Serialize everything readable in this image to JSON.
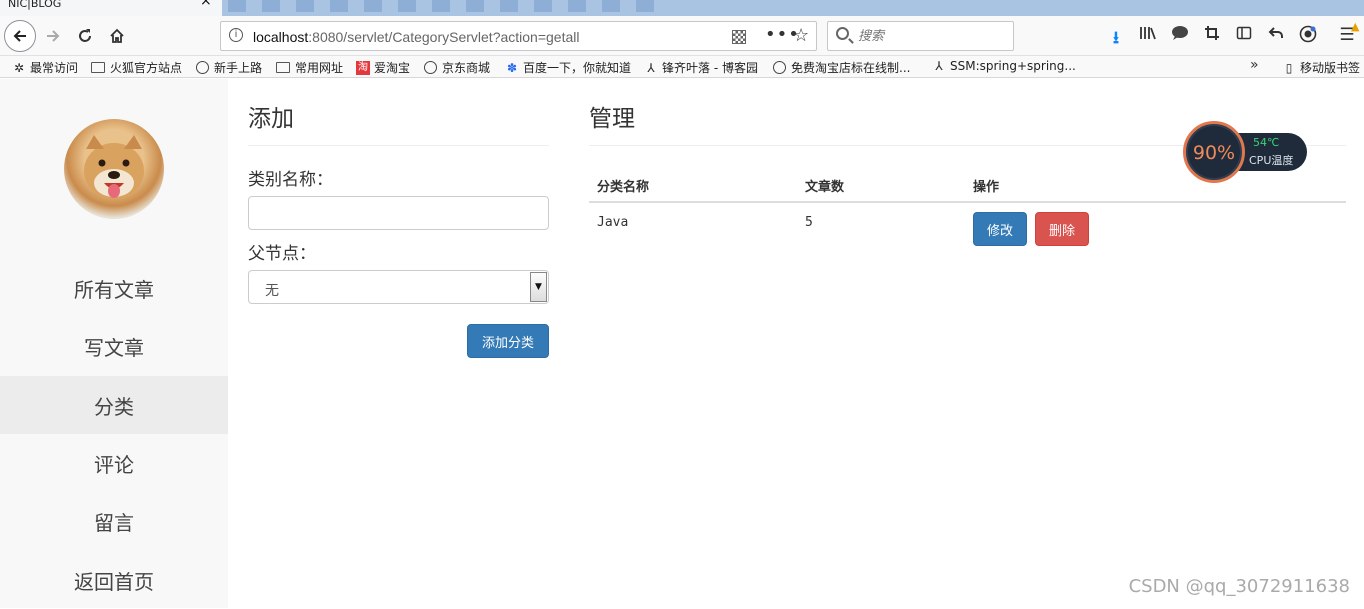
{
  "browser": {
    "tab_title": "NIC|BLOG",
    "tab_close": "×",
    "url_host": "localhost",
    "url_rest": ":8080/servlet/CategoryServlet?action=getall",
    "search_placeholder": "搜索",
    "bookmarks": [
      "最常访问",
      "火狐官方站点",
      "新手上路",
      "常用网址",
      "爱淘宝",
      "京东商城",
      "百度一下，你就知道",
      "锋齐叶落 - 博客园",
      "免费淘宝店标在线制...",
      "SSM:spring+spring...",
      "移动版书签"
    ],
    "bookmarks_more": "»"
  },
  "sidebar": {
    "items": [
      "所有文章",
      "写文章",
      "分类",
      "评论",
      "留言",
      "返回首页"
    ],
    "active_index": 2
  },
  "add_panel": {
    "title": "添加",
    "name_label": "类别名称：",
    "name_value": "",
    "parent_label": "父节点：",
    "parent_selected": "无",
    "submit_label": "添加分类"
  },
  "manage_panel": {
    "title": "管理",
    "columns": [
      "分类名称",
      "文章数",
      "操作"
    ],
    "rows": [
      {
        "name": "Java",
        "count": "5",
        "edit_label": "修改",
        "delete_label": "删除"
      }
    ]
  },
  "cpu_widget": {
    "percent": "90%",
    "temperature": "54℃",
    "label": "CPU温度"
  },
  "watermark": "CSDN @qq_3072911638",
  "colors": {
    "primary": "#337ab7",
    "danger": "#d9534f",
    "sidebar_bg": "#f8f8f8",
    "sidebar_active": "#ececec"
  }
}
